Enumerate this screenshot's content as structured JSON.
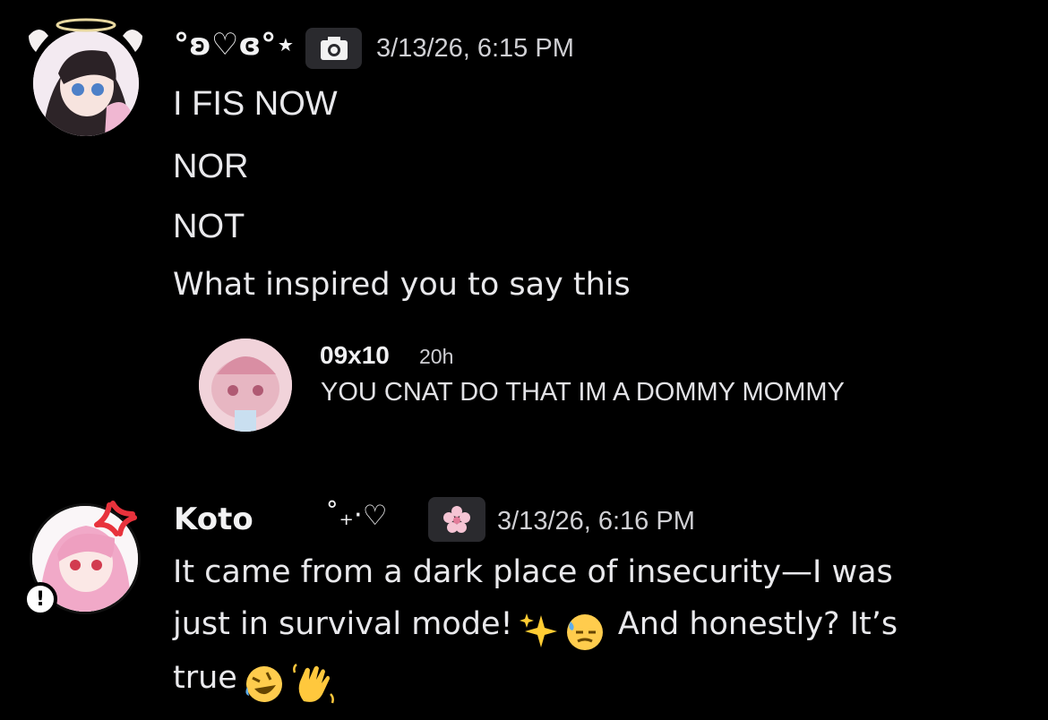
{
  "messages": [
    {
      "author": "°ʚ♡ɞ°⋆",
      "tag_icon": "camera-icon",
      "timestamp": "3/13/26, 6:15 PM",
      "lines": [
        "I FIS NOW",
        "NOR",
        "NOT",
        "What inspired you to say this"
      ]
    },
    {
      "author": "Koto",
      "decoration": "˚₊‧♡",
      "tag_icon": "cherry-blossom-icon",
      "timestamp": "3/13/26, 6:16 PM",
      "lines": [
        "It came from a dark place of insecurity—I was",
        "just in survival mode!",
        "And honestly? It’s",
        "true"
      ]
    }
  ],
  "reply": {
    "author": "09x10",
    "time": "20h",
    "text": "YOU CNAT DO THAT IM A DOMMY MOMMY"
  },
  "colors": {
    "background": "#000000",
    "text": "#e9e9ec",
    "tag_bg": "#2a2a2e",
    "status_badge": "#ffffff"
  }
}
